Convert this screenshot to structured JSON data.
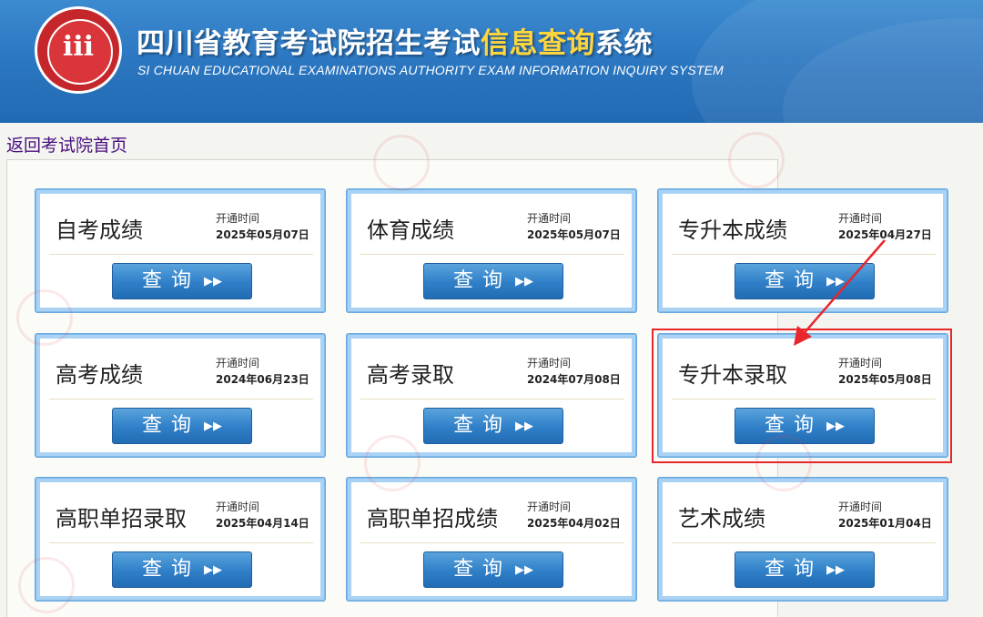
{
  "header": {
    "title_part1": "四川省教育考试院招生考试",
    "title_part2": "信息查询",
    "title_part3": "系统",
    "subtitle": "SI CHUAN EDUCATIONAL EXAMINATIONS AUTHORITY EXAM INFORMATION INQUIRY SYSTEM",
    "logo_mark": "ⅲ"
  },
  "nav": {
    "back_link": "返回考试院首页"
  },
  "cards": [
    {
      "title": "自考成绩",
      "open_label": "开通时间",
      "open_date": "2025年05月07日",
      "button": "查询"
    },
    {
      "title": "体育成绩",
      "open_label": "开通时间",
      "open_date": "2025年05月07日",
      "button": "查询"
    },
    {
      "title": "专升本成绩",
      "open_label": "开通时间",
      "open_date": "2025年04月27日",
      "button": "查询"
    },
    {
      "title": "高考成绩",
      "open_label": "开通时间",
      "open_date": "2024年06月23日",
      "button": "查询"
    },
    {
      "title": "高考录取",
      "open_label": "开通时间",
      "open_date": "2024年07月08日",
      "button": "查询"
    },
    {
      "title": "专升本录取",
      "open_label": "开通时间",
      "open_date": "2025年05月08日",
      "button": "查询"
    },
    {
      "title": "高职单招录取",
      "open_label": "开通时间",
      "open_date": "2025年04月14日",
      "button": "查询"
    },
    {
      "title": "高职单招成绩",
      "open_label": "开通时间",
      "open_date": "2025年04月02日",
      "button": "查询"
    },
    {
      "title": "艺术成绩",
      "open_label": "开通时间",
      "open_date": "2025年01月04日",
      "button": "查询"
    }
  ],
  "colors": {
    "header_blue": "#2d78c2",
    "title_highlight": "#ffd53d",
    "annotation_red": "#e8262c",
    "button_blue": "#2f7fc8"
  }
}
